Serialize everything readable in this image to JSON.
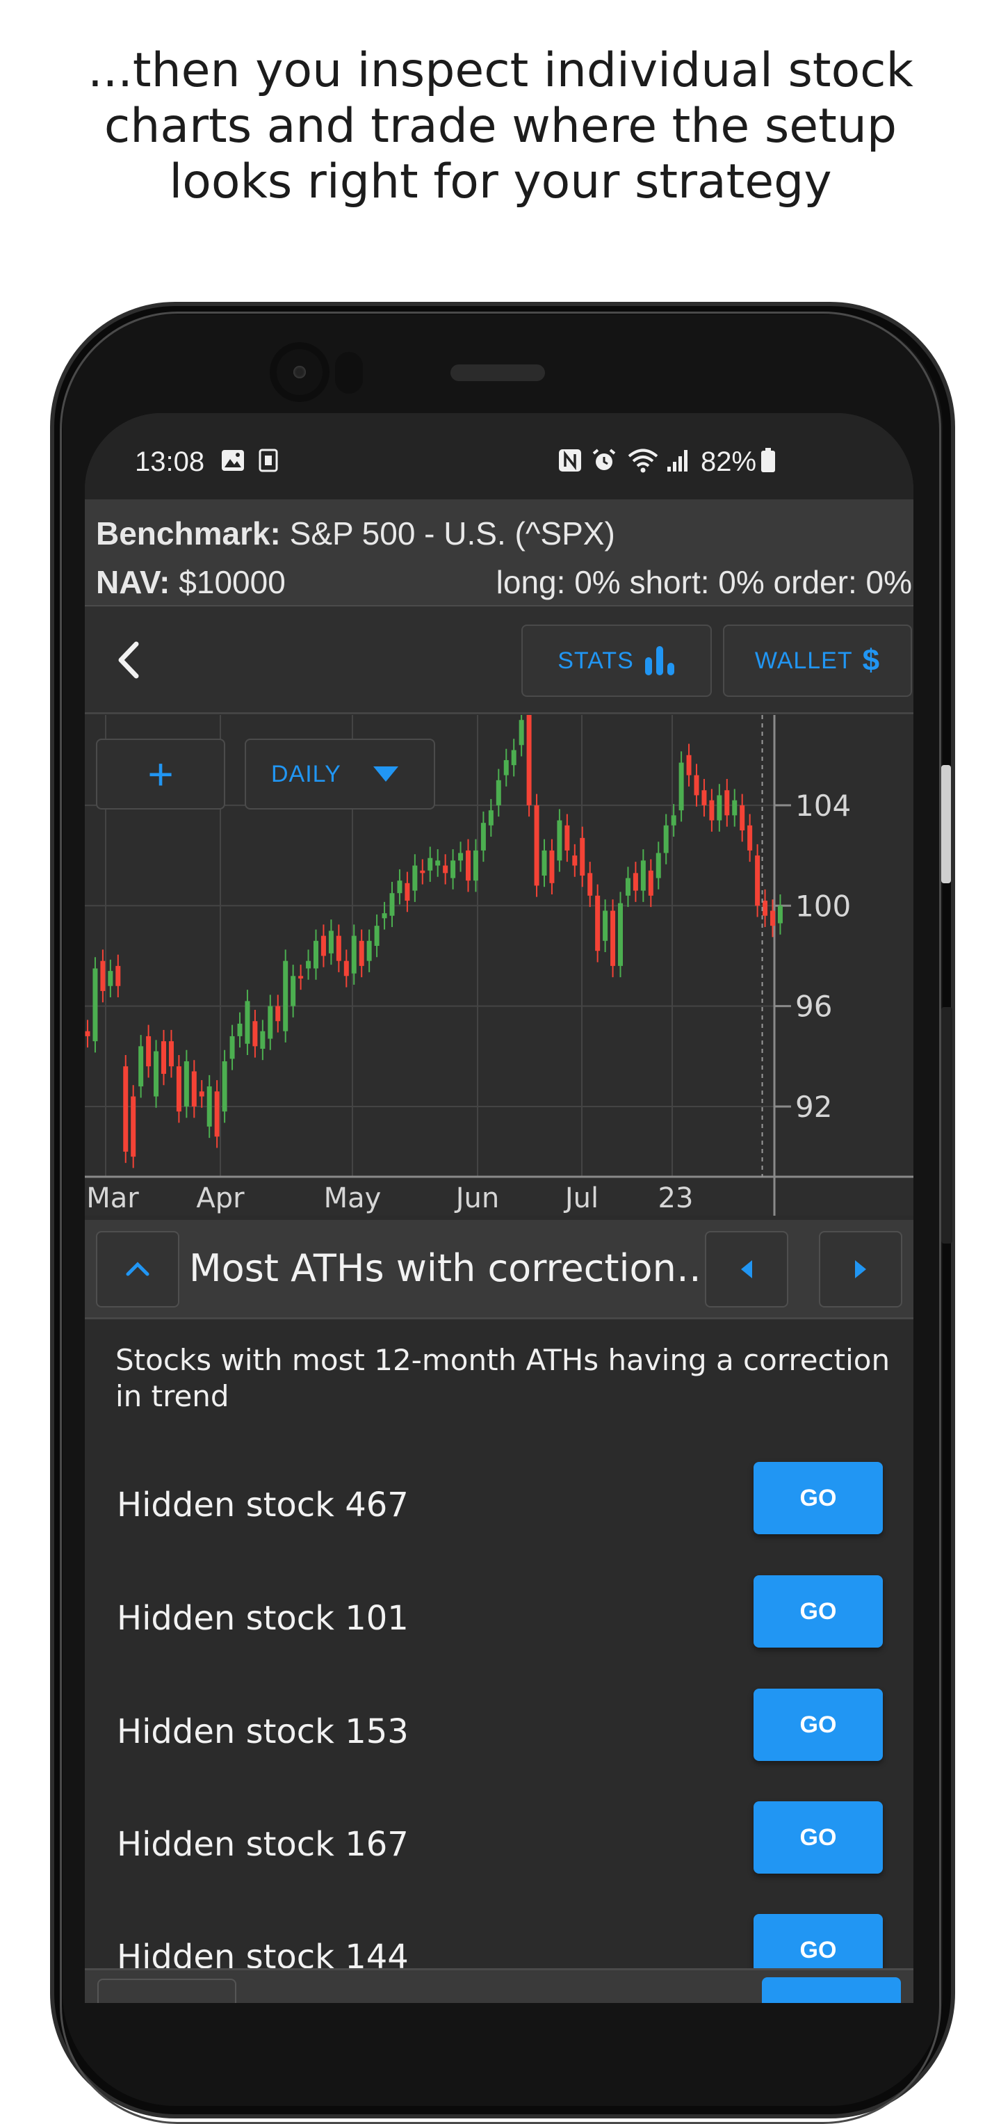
{
  "headline": {
    "lines": [
      "...then you inspect individual stock",
      "charts and trade where the setup",
      "looks right for your strategy"
    ]
  },
  "status_bar": {
    "time": "13:08",
    "battery": "82%"
  },
  "benchmark": {
    "label": "Benchmark:",
    "value": "S&P 500 - U.S. (^SPX)",
    "nav_label": "NAV:",
    "nav_value": "$10000",
    "exposure": "long: 0% short: 0% order: 0%"
  },
  "toolbar": {
    "stats_label": "STATS",
    "wallet_label": "WALLET",
    "wallet_symbol": "$"
  },
  "chart_controls": {
    "add_symbol": "+",
    "interval": "DAILY"
  },
  "chart_data": {
    "type": "candlestick",
    "x_tick_labels": [
      "Mar",
      "Apr",
      "May",
      "Jun",
      "Jul",
      "23"
    ],
    "y_tick_labels": [
      "104",
      "100",
      "96",
      "92"
    ],
    "ylim": [
      89.2,
      107.6
    ],
    "grid": true,
    "colors": {
      "up": "#4caf50",
      "down": "#f44336",
      "grid": "#444444",
      "axis": "#8a8a8a"
    },
    "bars": [
      [
        95.0,
        94.8
      ],
      [
        94.6,
        97.5
      ],
      [
        97.8,
        96.6
      ],
      [
        96.8,
        97.4
      ],
      [
        97.6,
        96.8
      ],
      [
        93.6,
        90.2
      ],
      [
        92.4,
        90.0
      ],
      [
        92.8,
        94.4
      ],
      [
        94.8,
        93.6
      ],
      [
        92.4,
        94.2
      ],
      [
        94.6,
        93.3
      ],
      [
        94.6,
        93.6
      ],
      [
        93.6,
        91.8
      ],
      [
        92.0,
        93.8
      ],
      [
        93.4,
        92.0
      ],
      [
        92.6,
        92.4
      ],
      [
        91.2,
        92.8
      ],
      [
        92.6,
        90.8
      ],
      [
        91.8,
        93.8
      ],
      [
        93.9,
        94.8
      ],
      [
        94.8,
        95.3
      ],
      [
        94.5,
        96.2
      ],
      [
        95.4,
        94.4
      ],
      [
        94.3,
        95.0
      ],
      [
        94.7,
        96.0
      ],
      [
        96.0,
        95.4
      ],
      [
        95.0,
        97.8
      ],
      [
        96.0,
        97.2
      ],
      [
        97.2,
        97.1
      ],
      [
        97.5,
        97.8
      ],
      [
        97.5,
        98.6
      ],
      [
        98.8,
        98.0
      ],
      [
        98.1,
        99.0
      ],
      [
        98.8,
        97.8
      ],
      [
        97.8,
        97.2
      ],
      [
        97.3,
        98.8
      ],
      [
        98.6,
        97.6
      ],
      [
        97.8,
        98.6
      ],
      [
        98.4,
        99.2
      ],
      [
        99.5,
        99.7
      ],
      [
        99.6,
        100.5
      ],
      [
        100.5,
        101.0
      ],
      [
        100.9,
        100.2
      ],
      [
        100.6,
        101.6
      ],
      [
        101.4,
        101.3
      ],
      [
        101.4,
        101.9
      ],
      [
        101.6,
        101.8
      ],
      [
        101.6,
        101.3
      ],
      [
        101.1,
        101.8
      ],
      [
        101.8,
        102.1
      ],
      [
        102.2,
        101.0
      ],
      [
        101.0,
        102.2
      ],
      [
        102.2,
        103.3
      ],
      [
        103.2,
        103.8
      ],
      [
        104.0,
        105.0
      ],
      [
        105.2,
        105.8
      ],
      [
        105.6,
        106.2
      ],
      [
        106.4,
        107.4
      ],
      [
        107.6,
        104.0
      ],
      [
        104.0,
        100.8
      ],
      [
        101.2,
        102.2
      ],
      [
        102.2,
        100.9
      ],
      [
        101.8,
        103.4
      ],
      [
        103.2,
        102.2
      ],
      [
        102.0,
        101.6
      ],
      [
        102.7,
        101.2
      ],
      [
        101.3,
        100.4
      ],
      [
        100.4,
        98.2
      ],
      [
        98.6,
        99.8
      ],
      [
        99.8,
        97.6
      ],
      [
        97.6,
        100.1
      ],
      [
        100.4,
        101.1
      ],
      [
        101.3,
        100.6
      ],
      [
        100.6,
        101.8
      ],
      [
        101.4,
        100.4
      ],
      [
        101.1,
        102.1
      ],
      [
        102.1,
        103.2
      ],
      [
        103.2,
        103.6
      ],
      [
        103.8,
        105.7
      ],
      [
        106.0,
        105.2
      ],
      [
        105.2,
        104.4
      ],
      [
        104.6,
        104.0
      ],
      [
        104.2,
        103.4
      ],
      [
        103.4,
        104.4
      ],
      [
        104.6,
        103.6
      ],
      [
        103.6,
        104.2
      ],
      [
        104.0,
        103.0
      ],
      [
        103.2,
        102.2
      ],
      [
        102.0,
        100.0
      ],
      [
        100.2,
        99.6
      ],
      [
        99.8,
        99.2
      ],
      [
        99.3,
        100.0
      ]
    ],
    "current_bar_index": 89
  },
  "screener": {
    "title": "Most ATHs with correction…"
  },
  "description": "Stocks with most 12-month ATHs having a correction in trend",
  "stocks": [
    {
      "name": "Hidden stock 467",
      "action": "GO"
    },
    {
      "name": "Hidden stock 101",
      "action": "GO"
    },
    {
      "name": "Hidden stock 153",
      "action": "GO"
    },
    {
      "name": "Hidden stock 167",
      "action": "GO"
    },
    {
      "name": "Hidden stock 144",
      "action": "GO"
    }
  ]
}
